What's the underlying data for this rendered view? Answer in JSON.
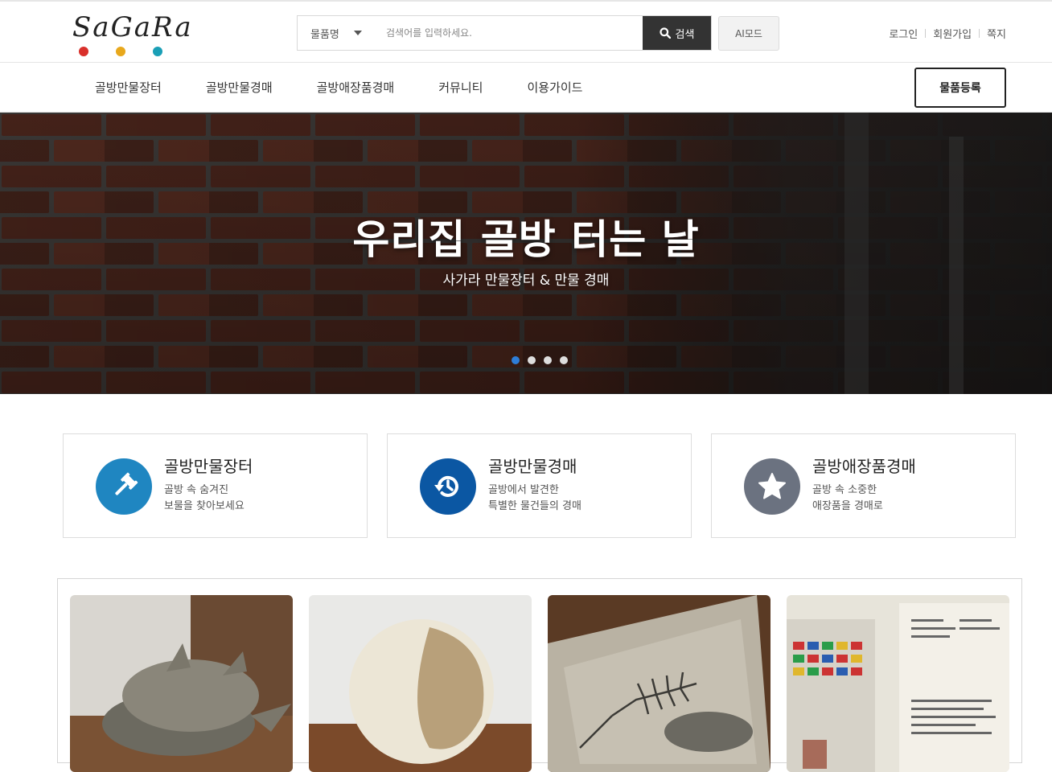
{
  "logo": {
    "text": "SaGaRa",
    "dot_colors": [
      "#d9302b",
      "#e8a81c",
      "#1a9fb6"
    ]
  },
  "search": {
    "category": "물품명",
    "placeholder": "검색어를 입력하세요.",
    "button_label": "검색",
    "ai_mode_label": "AI모드"
  },
  "util_links": [
    "로그인",
    "회원가입",
    "쪽지"
  ],
  "nav": {
    "items": [
      "골방만물장터",
      "골방만물경매",
      "골방애장품경매",
      "커뮤니티",
      "이용가이드"
    ],
    "register_label": "물품등록"
  },
  "hero": {
    "title": "우리집 골방 터는 날",
    "subtitle": "사가라 만물장터 & 만물 경매",
    "slide_count": 4,
    "active_slide": 1
  },
  "features": [
    {
      "title": "골방만물장터",
      "desc1": "골방 속 숨겨진",
      "desc2": "보물을 찾아보세요",
      "icon": "gavel-icon",
      "color": "#1f86c1"
    },
    {
      "title": "골방만물경매",
      "desc1": "골방에서 발견한",
      "desc2": "특별한 물건들의 경매",
      "icon": "history-icon",
      "color": "#0b57a3"
    },
    {
      "title": "골방애장품경매",
      "desc1": "골방 속 소중한",
      "desc2": "애장품을 경매로",
      "icon": "star-icon",
      "color": "#6b7280"
    }
  ],
  "products": [
    {
      "image": "pottery-image"
    },
    {
      "image": "stone-ball-image"
    },
    {
      "image": "fossil-image"
    },
    {
      "image": "stamp-book-image"
    }
  ]
}
